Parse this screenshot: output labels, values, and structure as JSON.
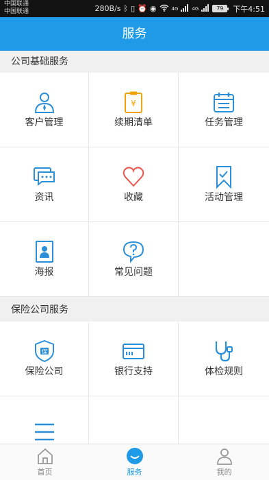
{
  "status_bar": {
    "carrier_1": "中国联通",
    "carrier_2": "中国联通",
    "net_speed": "280B/s",
    "network_1": "4G",
    "network_2": "4G",
    "battery": "79",
    "time": "下午4:51"
  },
  "header": {
    "title": "服务"
  },
  "sections": [
    {
      "title": "公司基础服务"
    },
    {
      "title": "保险公司服务"
    }
  ],
  "base_services": [
    {
      "label": "客户管理",
      "icon": "customer-icon"
    },
    {
      "label": "续期清单",
      "icon": "renewal-list-icon"
    },
    {
      "label": "任务管理",
      "icon": "calendar-icon"
    },
    {
      "label": "资讯",
      "icon": "chat-icon"
    },
    {
      "label": "收藏",
      "icon": "heart-icon"
    },
    {
      "label": "活动管理",
      "icon": "bookmark-icon"
    },
    {
      "label": "海报",
      "icon": "poster-icon"
    },
    {
      "label": "常见问题",
      "icon": "question-icon"
    }
  ],
  "insurer_services": [
    {
      "label": "保险公司",
      "icon": "shield-icon"
    },
    {
      "label": "银行支持",
      "icon": "bank-card-icon"
    },
    {
      "label": "体检规则",
      "icon": "stethoscope-icon"
    },
    {
      "label": "",
      "icon": "menu-icon"
    }
  ],
  "tabbar": {
    "home": "首页",
    "service": "服务",
    "mine": "我的"
  },
  "colors": {
    "primary": "#1e9ae6",
    "icon_blue": "#2a8fd8",
    "icon_orange": "#f0a20a",
    "icon_red": "#e8564d"
  }
}
